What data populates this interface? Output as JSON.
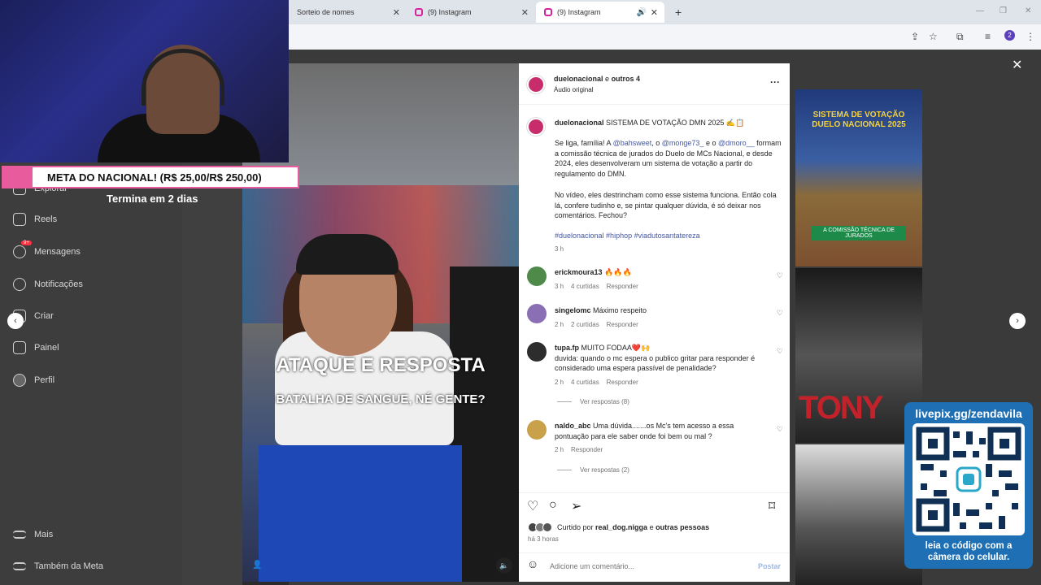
{
  "browser": {
    "tabs": [
      {
        "label": "Sorteio de nomes"
      },
      {
        "label": "(9) Instagram"
      },
      {
        "label": "(9) Instagram"
      }
    ],
    "new_tab": "+",
    "profile_badge": "2"
  },
  "stream": {
    "goal_banner": "META DO NACIONAL! (R$ 25,00/R$ 250,00)",
    "goal_subtitle": "Termina em 2 dias",
    "qr_title": "livepix.gg/zendavila",
    "qr_footer_line1": "leia o código com a",
    "qr_footer_line2": "câmera do celular."
  },
  "sidebar": {
    "items": [
      {
        "label": "Explorar",
        "icon": "compass-icon"
      },
      {
        "label": "Reels",
        "icon": "reels-icon"
      },
      {
        "label": "Mensagens",
        "icon": "messenger-icon",
        "badge": "9+"
      },
      {
        "label": "Notificações",
        "icon": "heart-icon"
      },
      {
        "label": "Criar",
        "icon": "plus-icon"
      },
      {
        "label": "Painel",
        "icon": "chart-icon"
      },
      {
        "label": "Perfil",
        "icon": "avatar-icon"
      },
      {
        "label": "Mais",
        "icon": "menu-icon"
      },
      {
        "label": "Também da Meta",
        "icon": "meta-icon"
      }
    ]
  },
  "video": {
    "caption_big": "ATAQUE E RESPOSTA",
    "caption_small": "BATALHA DE SANGUE, NÉ GENTE?"
  },
  "post": {
    "header_user": "duelonacional",
    "header_and": "e",
    "header_others": "outros 4",
    "header_audio": "Áudio original",
    "caption_user": "duelonacional",
    "caption_title": "SISTEMA DE VOTAÇÃO DMN 2025 ✍️📋",
    "caption_p1_a": "Se liga, família! A",
    "mention1": "@bahsweet",
    "caption_p1_b": ", o",
    "mention2": "@monge73_",
    "caption_p1_c": " e o",
    "mention3": "@dmoro__",
    "caption_p1_d": "formam a comissão técnica de jurados do Duelo de MCs Nacional, e desde 2024, eles desenvolveram um sistema de votação a partir do regulamento do DMN.",
    "caption_p2": "No vídeo, eles destrincham como esse sistema funciona. Então cola lá, confere tudinho e, se pintar qualquer dúvida, é só deixar nos comentários. Fechou?",
    "hashtags": "#duelonacional #hiphop #viadutosantatereza",
    "caption_time": "3 h",
    "comments": [
      {
        "user": "erickmoura13",
        "text": "🔥🔥🔥",
        "time": "3 h",
        "likes": "4 curtidas",
        "reply": "Responder"
      },
      {
        "user": "singelomc",
        "text": "Máximo respeito",
        "time": "2 h",
        "likes": "2 curtidas",
        "reply": "Responder"
      },
      {
        "user": "tupa.fp",
        "text": "MUITO FODAA❤️🙌",
        "text2": "duvida: quando o mc espera o publico gritar para responder é considerado uma espera passível de penalidade?",
        "time": "2 h",
        "likes": "4 curtidas",
        "reply": "Responder"
      },
      {
        "user": "naldo_abc",
        "text": "Uma dúvida.......os Mc's tem acesso a essa pontuação para ele saber onde foi bem ou mal ?",
        "time": "2 h",
        "reply": "Responder"
      }
    ],
    "view_replies_1": "Ver respostas (8)",
    "view_replies_2": "Ver respostas (2)",
    "liked_by_prefix": "Curtido por",
    "liked_by_user": "real_dog.nigga",
    "liked_by_and": "e",
    "liked_by_others": "outras pessoas",
    "post_time": "há 3 horas",
    "comment_placeholder": "Adicione um comentário...",
    "post_button": "Postar"
  },
  "thumbs": {
    "t1_title": "SISTEMA DE VOTAÇÃO DUELO NACIONAL 2025",
    "t1_caption": "A COMISSÃO TÉCNICA DE JURADOS",
    "t2_text": "TONY"
  },
  "colors": {
    "brand_pink": "#e85b9c",
    "livepix_blue": "#1e6fb3",
    "ig_link": "#00376b"
  }
}
